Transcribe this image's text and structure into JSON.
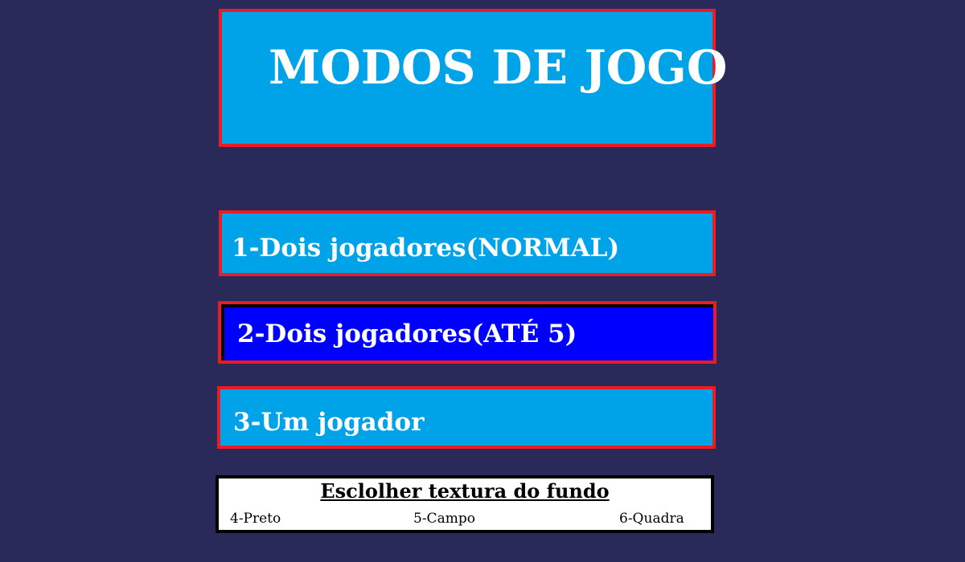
{
  "title": "MODOS DE JOGO",
  "modes": [
    {
      "label": "1-Dois jogadores(NORMAL)"
    },
    {
      "label": "2-Dois jogadores(ATÉ 5)"
    },
    {
      "label": "3-Um jogador"
    }
  ],
  "selected_mode_index": 1,
  "texture": {
    "title": "Esclolher textura do fundo",
    "options": [
      {
        "label": "4-Preto"
      },
      {
        "label": "5-Campo"
      },
      {
        "label": "6-Quadra"
      }
    ]
  },
  "colors": {
    "background": "#29295a",
    "button": "#00a2e8",
    "button_selected": "#0000ff",
    "border": "#ed1c24",
    "text": "#ffffff"
  }
}
